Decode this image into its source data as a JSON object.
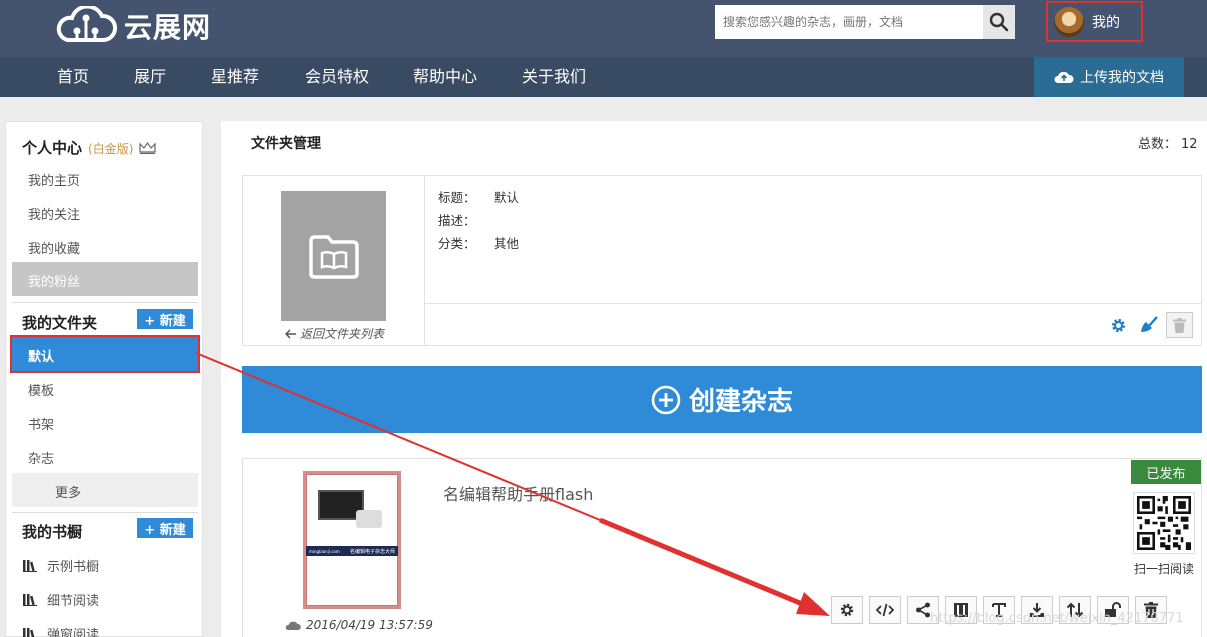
{
  "header": {
    "logo_text": "云展网",
    "search_placeholder": "搜索您感兴趣的杂志，画册，文档",
    "user_label": "我的"
  },
  "nav": {
    "items": [
      "首页",
      "展厅",
      "星推荐",
      "会员特权",
      "帮助中心",
      "关于我们"
    ],
    "upload_label": "上传我的文档"
  },
  "sidebar": {
    "personal_title": "个人中心",
    "personal_tag": "(白金版)",
    "personal_items": [
      "我的主页",
      "我的关注",
      "我的收藏",
      "我的粉丝"
    ],
    "folders_title": "我的文件夹",
    "new_label": "+ 新建",
    "folder_items": [
      "默认",
      "模板",
      "书架",
      "杂志"
    ],
    "more_label": "更多",
    "bookshelf_title": "我的书橱",
    "bookshelf_items": [
      "示例书橱",
      "细节阅读",
      "弹窗阅读"
    ]
  },
  "main": {
    "title": "文件夹管理",
    "total_label": "总数：",
    "total_value": "12",
    "back_label": "返回文件夹列表",
    "fields": [
      {
        "label": "标题：",
        "value": "默认"
      },
      {
        "label": "描述：",
        "value": ""
      },
      {
        "label": "分类：",
        "value": "其他"
      }
    ],
    "create_label": "创建杂志"
  },
  "magazine": {
    "title": "名编辑帮助手册flash",
    "status": "已发布",
    "scan_label": "扫一扫阅读",
    "date": "2016/04/19 13:57:59",
    "cover_caption": "名编辑电子杂志大师",
    "cover_url": "mingbianji.com"
  },
  "watermark": "https://blog.csdn.net/weixin_42170771",
  "colors": {
    "header_bg": "#44546e",
    "nav_bg": "#394a63",
    "accent_blue": "#2f8ad8",
    "upload_bg": "#2b6c95",
    "status_green": "#3a8a3e",
    "highlight_red": "#e0302f"
  },
  "icons": {
    "logo": "cloud-logo-icon",
    "search": "search-icon",
    "upload": "cloud-upload-icon",
    "crown": "crown-icon",
    "folder": "folder-book-icon",
    "back": "arrow-left-icon",
    "settings": "gear-icon",
    "brush": "brush-icon",
    "delete": "trash-icon",
    "create": "plus-circle-icon",
    "date": "cloud-icon",
    "bookshelf": "bookshelf-icon"
  }
}
